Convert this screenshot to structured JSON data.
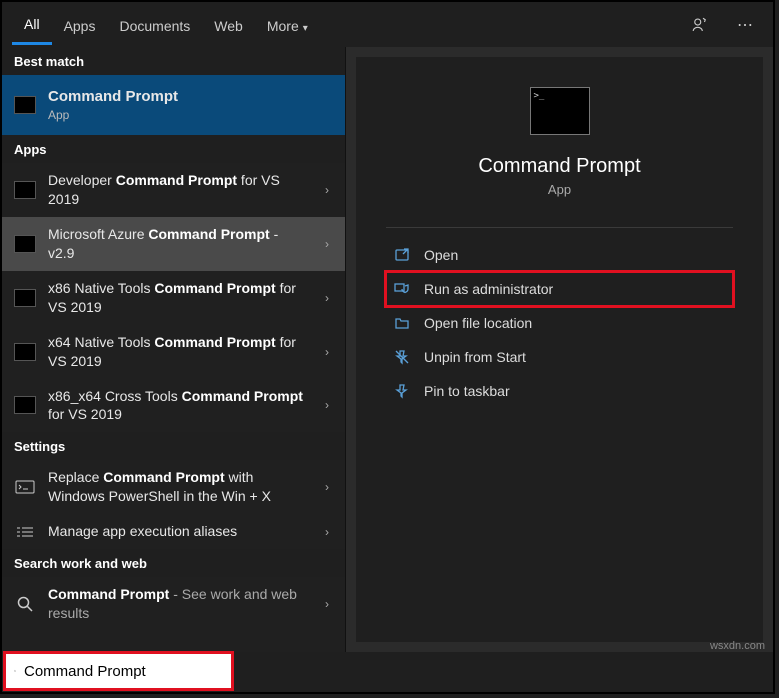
{
  "tabs": {
    "all": "All",
    "apps": "Apps",
    "documents": "Documents",
    "web": "Web",
    "more": "More"
  },
  "groups": {
    "best": "Best match",
    "apps": "Apps",
    "settings": "Settings",
    "webwork": "Search work and web"
  },
  "best": {
    "title": "Command Prompt",
    "sub": "App"
  },
  "appsList": {
    "a0_pre": "Developer ",
    "a0_b": "Command Prompt",
    "a0_post": " for VS 2019",
    "a1_pre": "Microsoft Azure ",
    "a1_b": "Command Prompt",
    "a1_post": " - v2.9",
    "a2_pre": "x86 Native Tools ",
    "a2_b": "Command Prompt",
    "a2_post": " for VS 2019",
    "a3_pre": "x64 Native Tools ",
    "a3_b": "Command Prompt",
    "a3_post": " for VS 2019",
    "a4_pre": "x86_x64 Cross Tools ",
    "a4_b": "Command Prompt",
    "a4_post": " for VS 2019"
  },
  "settingsList": {
    "s0_pre": "Replace ",
    "s0_b": "Command Prompt",
    "s0_post": " with Windows PowerShell in the Win + X",
    "s1": "Manage app execution aliases"
  },
  "webList": {
    "w0_b": "Command Prompt",
    "w0_post": " - See work and web results"
  },
  "preview": {
    "title": "Command Prompt",
    "sub": "App"
  },
  "actions": {
    "open": "Open",
    "admin": "Run as administrator",
    "loc": "Open file location",
    "unpin": "Unpin from Start",
    "pin": "Pin to taskbar"
  },
  "search": {
    "value": "Command Prompt"
  },
  "watermark": "wsxdn.com"
}
